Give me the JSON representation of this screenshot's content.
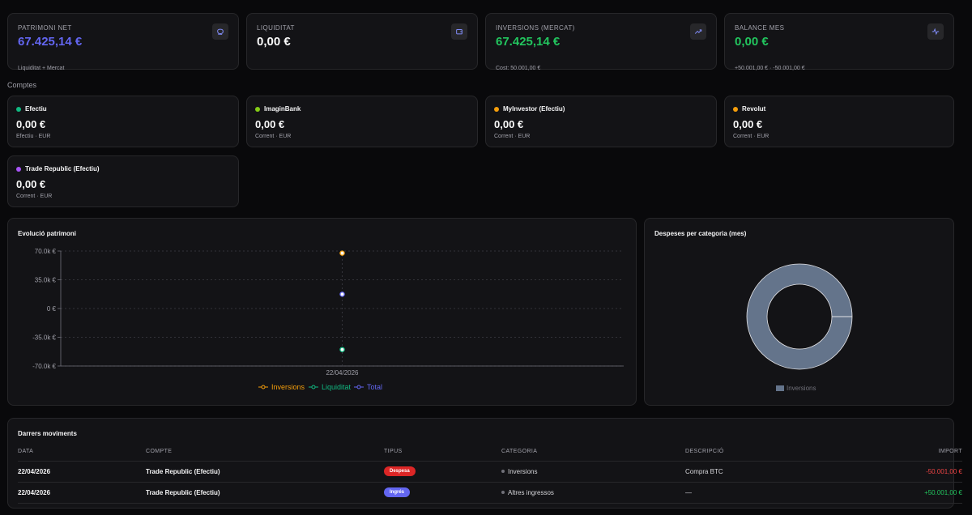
{
  "stats": [
    {
      "label": "Patrimoni net",
      "value": "67.425,14 €",
      "sub": "Liquiditat + Mercat",
      "color": "#6366f1",
      "icon": "piggy-bank-icon"
    },
    {
      "label": "Liquiditat",
      "value": "0,00 €",
      "sub": "",
      "color": "#fafafa",
      "icon": "wallet-icon"
    },
    {
      "label": "Inversions (Mercat)",
      "value": "67.425,14 €",
      "sub": "Cost: 50.001,00 €",
      "color": "#22c55e",
      "icon": "trending-up-icon"
    },
    {
      "label": "Balance mes",
      "value": "0,00 €",
      "sub": "+50.001,00 € · -50.001,00 €",
      "color": "#22c55e",
      "icon": "activity-icon"
    }
  ],
  "accounts_title": "Comptes",
  "accounts": [
    {
      "name": "Efectiu",
      "value": "0,00 €",
      "sub": "Efectiu · EUR",
      "color": "#10b981"
    },
    {
      "name": "ImaginBank",
      "value": "0,00 €",
      "sub": "Corrent · EUR",
      "color": "#84cc16"
    },
    {
      "name": "MyInvestor (Efectiu)",
      "value": "0,00 €",
      "sub": "Corrent · EUR",
      "color": "#f59e0b"
    },
    {
      "name": "Revolut",
      "value": "0,00 €",
      "sub": "Corrent · EUR",
      "color": "#f59e0b"
    },
    {
      "name": "Trade Republic (Efectiu)",
      "value": "0,00 €",
      "sub": "Corrent · EUR",
      "color": "#a855f7"
    }
  ],
  "evolution": {
    "title": "Evolució patrimoni"
  },
  "chart_data": [
    {
      "type": "line",
      "title": "Evolució patrimoni",
      "x": [
        "22/04/2026"
      ],
      "yticks": [
        "70.0k €",
        "35.0k €",
        "0 €",
        "-35.0k €",
        "-70.0k €"
      ],
      "ylim": [
        -70000,
        70000
      ],
      "grid": true,
      "legend": "bottom",
      "series": [
        {
          "name": "Inversions",
          "values": [
            67425.14
          ],
          "color": "#f59e0b"
        },
        {
          "name": "Liquiditat",
          "values": [
            -50001
          ],
          "color": "#10b981"
        },
        {
          "name": "Total",
          "values": [
            17424.14
          ],
          "color": "#6366f1"
        }
      ]
    },
    {
      "type": "pie",
      "title": "Despeses per categoria (mes)",
      "categories": [
        "Inversions"
      ],
      "values": [
        50001
      ],
      "colors": [
        "#64748b"
      ],
      "legend": "bottom"
    }
  ],
  "expenses": {
    "title": "Despeses per categoria (mes)",
    "legend": "Inversions"
  },
  "movements": {
    "title": "Darrers moviments",
    "columns": {
      "date": "Data",
      "account": "Compte",
      "type": "Tipus",
      "category": "Categoria",
      "description": "Descripció",
      "amount": "Import"
    },
    "rows": [
      {
        "date": "22/04/2026",
        "account": "Trade Republic (Efectiu)",
        "type": "Despesa",
        "type_color": "#dc2626",
        "category": "Inversions",
        "description": "Compra BTC",
        "amount": "-50.001,00 €",
        "amount_color": "#ef4444"
      },
      {
        "date": "22/04/2026",
        "account": "Trade Republic (Efectiu)",
        "type": "Ingrés",
        "type_color": "#6366f1",
        "category": "Altres ingressos",
        "description": "—",
        "amount": "+50.001,00 €",
        "amount_color": "#22c55e"
      }
    ]
  }
}
